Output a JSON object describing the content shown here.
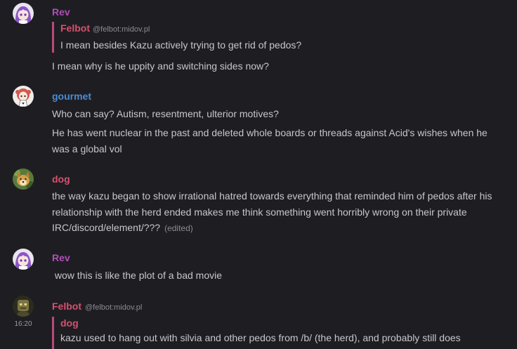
{
  "colors": {
    "background": "#1e1e22",
    "text": "#c6c6cb",
    "muted": "#8a8a90",
    "rev": "#b04db8",
    "gourmet": "#4a8cd6",
    "dog": "#d8506e",
    "felbot": "#d8506e",
    "quote_border": "#b84a7c"
  },
  "messages": [
    {
      "sender": "Rev",
      "avatar_icon": "anime-girl-purple-hair-avatar",
      "quote": {
        "sender": "Felbot",
        "handle": "@felbot:midov.pl",
        "text": "I mean besides Kazu actively trying to get rid of pedos?"
      },
      "text": "I mean why is he uppity and switching sides now?"
    },
    {
      "sender": "gourmet",
      "avatar_icon": "anime-girl-red-hair-avatar",
      "lines": [
        "Who can say? Autism, resentment, ulterior motives?",
        "He has went nuclear in the past and deleted whole boards or threads against Acid's wishes when he was a global vol"
      ]
    },
    {
      "sender": "dog",
      "avatar_icon": "dog-avatar",
      "text": "the way kazu began to show irrational hatred towards everything that reminded him of pedos after his relationship with the herd ended makes me think something went horribly wrong on their private IRC/discord/element/???",
      "edited": "(edited)"
    },
    {
      "sender": "Rev",
      "avatar_icon": "anime-girl-purple-hair-avatar",
      "text": " wow this is like the plot of a bad movie"
    },
    {
      "sender": "Felbot",
      "handle": "@felbot:midov.pl",
      "avatar_icon": "felbot-avatar",
      "timestamp": "16:20",
      "quote": {
        "sender": "dog",
        "text": "kazu used to hang out with silvia and other pedos from /b/ (the herd), and probably still does"
      }
    }
  ]
}
